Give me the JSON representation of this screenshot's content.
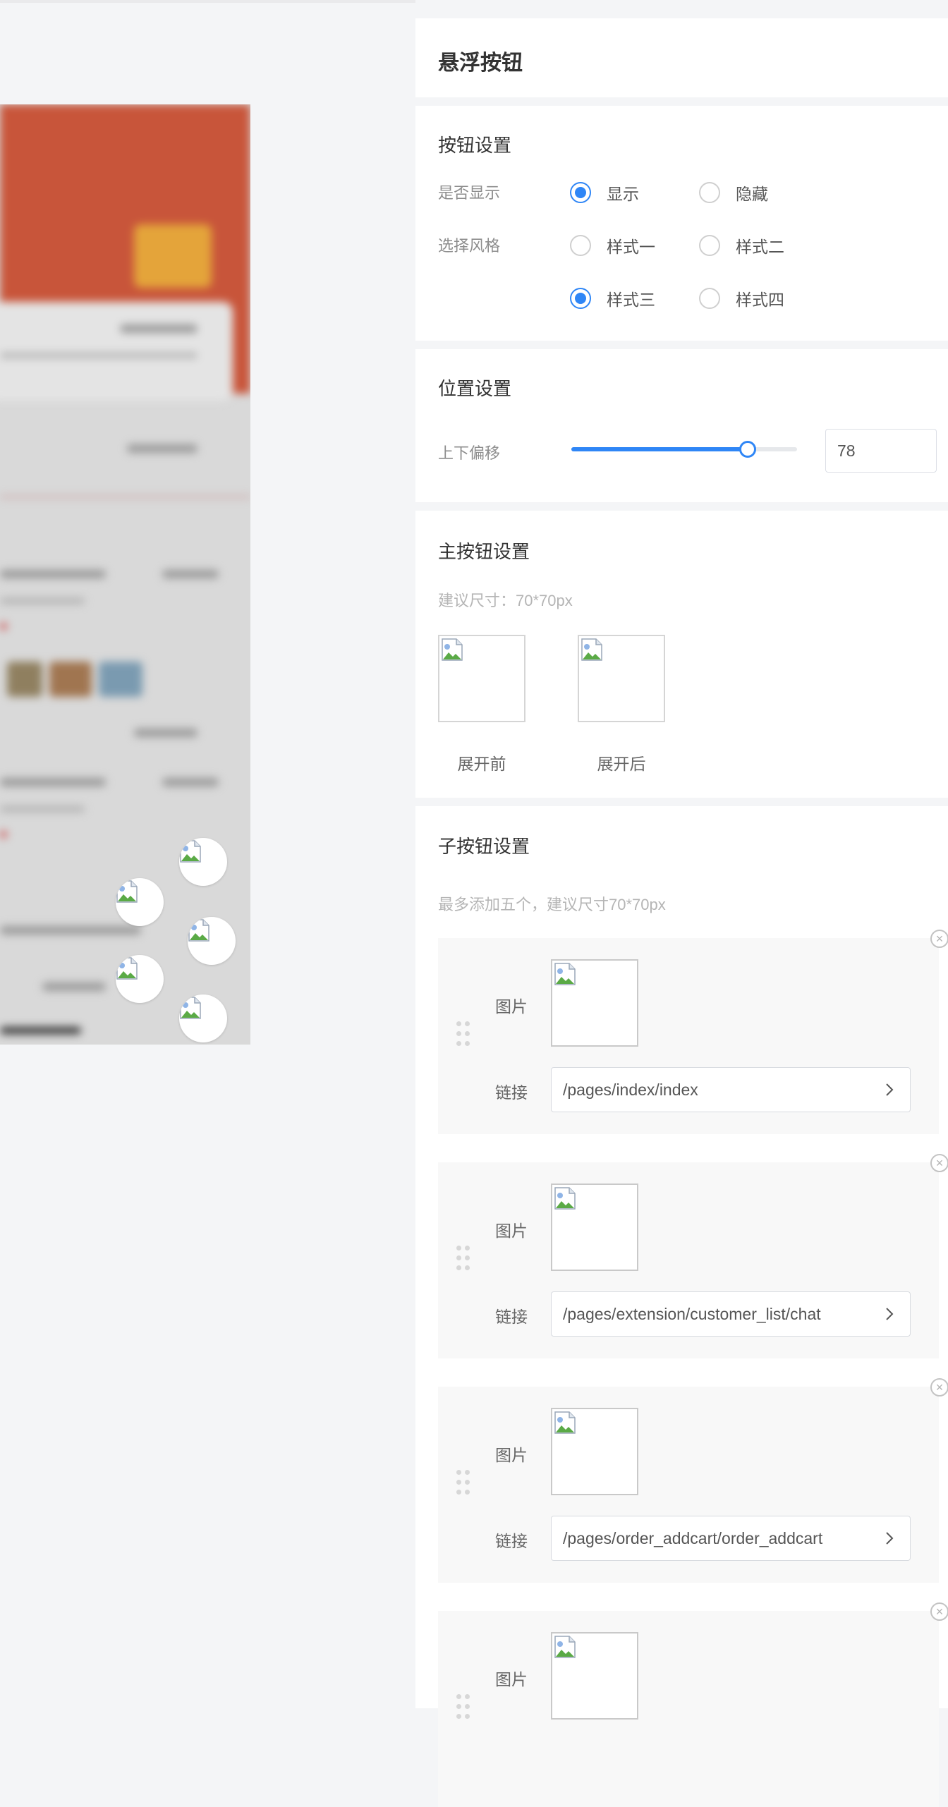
{
  "panel_title": "悬浮按钮",
  "button_settings": {
    "title": "按钮设置",
    "show_label": "是否显示",
    "show_options": [
      "显示",
      "隐藏"
    ],
    "show_selected": "显示",
    "style_label": "选择风格",
    "style_options": [
      "样式一",
      "样式二",
      "样式三",
      "样式四"
    ],
    "style_selected": "样式三"
  },
  "position_settings": {
    "title": "位置设置",
    "offset_label": "上下偏移",
    "offset_value": "78",
    "offset_fraction": 0.78
  },
  "main_button": {
    "title": "主按钮设置",
    "hint": "建议尺寸：70*70px",
    "before_caption": "展开前",
    "after_caption": "展开后"
  },
  "sub_buttons": {
    "title": "子按钮设置",
    "hint": "最多添加五个，建议尺寸70*70px",
    "image_label": "图片",
    "link_label": "链接",
    "items": [
      {
        "link": "/pages/index/index"
      },
      {
        "link": "/pages/extension/customer_list/chat"
      },
      {
        "link": "/pages/order_addcart/order_addcart"
      },
      {
        "link": ""
      }
    ]
  },
  "colors": {
    "accent": "#2f86f6",
    "preview_header": "#c8553a",
    "page_bg": "#f4f5f7"
  },
  "icons": [
    "broken-image-icon",
    "chevron-right-icon",
    "close-circle-icon",
    "drag-handle-icon"
  ]
}
